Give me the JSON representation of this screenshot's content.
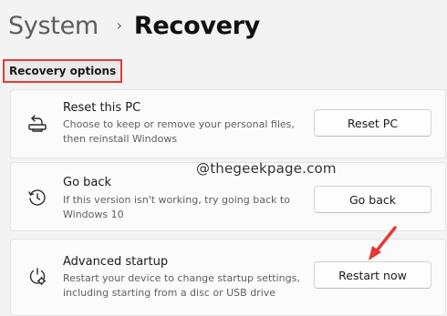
{
  "breadcrumb": {
    "parent": "System",
    "separator": "›",
    "current": "Recovery"
  },
  "section_label": "Recovery options",
  "cards": [
    {
      "title": "Reset this PC",
      "description": "Choose to keep or remove your personal files, then reinstall Windows",
      "button": "Reset PC",
      "icon": "reset-pc-icon"
    },
    {
      "title": "Go back",
      "description": "If this version isn't working, try going back to Windows 10",
      "button": "Go back",
      "icon": "go-back-history-icon"
    },
    {
      "title": "Advanced startup",
      "description": "Restart your device to change startup settings, including starting from a disc or USB drive",
      "button": "Restart now",
      "icon": "advanced-startup-power-gear-icon"
    }
  ],
  "watermark": "@thegeekpage.com",
  "colors": {
    "highlight_border": "#e53935",
    "annotation_arrow": "#e53935",
    "page_background": "#f3f3f3",
    "card_background": "#fbfbfb"
  }
}
